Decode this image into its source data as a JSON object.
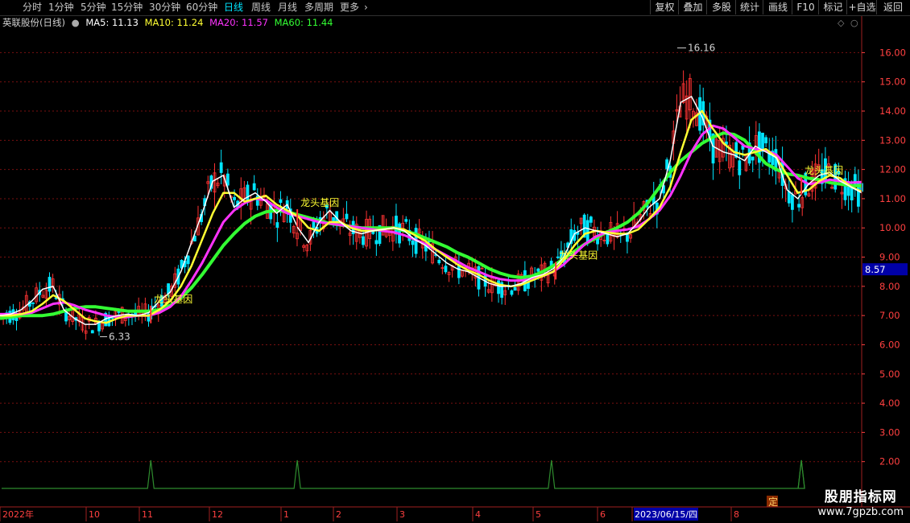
{
  "toolbar": {
    "period_tabs": [
      "分时",
      "1分钟",
      "5分钟",
      "15分钟",
      "30分钟",
      "60分钟",
      "日线",
      "周线",
      "月线",
      "多周期",
      "更多"
    ],
    "active_tab": "日线",
    "more_arrow": "›",
    "right_buttons": [
      "复权",
      "叠加",
      "多股",
      "统计",
      "画线",
      "F10",
      "标记",
      "+自选",
      "返回"
    ]
  },
  "legend": {
    "stock_name": "英联股份(日线)",
    "ma5": "MA5: 11.13",
    "ma10": "MA10: 11.24",
    "ma20": "MA20: 11.57",
    "ma60": "MA60: 11.44"
  },
  "colors": {
    "ma5": "#ffffff",
    "ma10": "#ffff33",
    "ma20": "#ff33ff",
    "ma60": "#33ff33",
    "up": "#ff3333",
    "down": "#00e5ff",
    "axis": "#ff4040",
    "signal": "#2e8b2e",
    "current_price_bg": "#0000a8"
  },
  "chart_data": {
    "type": "candlestick",
    "ylim": [
      1.0,
      16.7
    ],
    "y_ticks": [
      "16.00",
      "15.00",
      "14.00",
      "13.00",
      "12.00",
      "11.00",
      "10.00",
      "9.00",
      "8.00",
      "7.00",
      "6.00",
      "5.00",
      "4.00",
      "3.00",
      "2.00"
    ],
    "x_labels": [
      "2022年",
      "10",
      "11",
      "12",
      "1",
      "2",
      "3",
      "4",
      "5",
      "6",
      "2023/06/15/四",
      "8"
    ],
    "highlighted_date": "2023/06/15/四",
    "current_price": "8.57",
    "high_label": "16.16",
    "low_label": "6.33",
    "annotation_text": "龙头基因",
    "signal_marker": "定",
    "ma_series": {
      "ma5": [
        7.0,
        7.05,
        7.2,
        7.5,
        7.9,
        8.0,
        7.2,
        6.9,
        6.7,
        6.7,
        6.9,
        7.0,
        7.05,
        7.0,
        7.1,
        7.5,
        7.8,
        8.5,
        9.5,
        10.5,
        11.6,
        11.8,
        10.7,
        11.0,
        11.2,
        10.9,
        10.5,
        10.8,
        10.0,
        9.5,
        10.2,
        10.6,
        10.2,
        9.9,
        9.8,
        9.9,
        9.95,
        10.0,
        9.9,
        9.6,
        9.4,
        9.1,
        8.8,
        8.6,
        8.5,
        8.3,
        8.1,
        8.0,
        8.0,
        8.1,
        8.3,
        8.4,
        8.6,
        9.0,
        9.8,
        10.0,
        9.9,
        9.8,
        9.7,
        9.8,
        10.2,
        10.7,
        11.0,
        12.3,
        14.3,
        14.5,
        13.8,
        12.8,
        12.6,
        12.5,
        12.3,
        12.8,
        12.6,
        12.4,
        11.3,
        11.0,
        11.5,
        11.8,
        11.9,
        11.6,
        11.4,
        11.2
      ],
      "ma10": [
        7.0,
        7.0,
        7.05,
        7.15,
        7.4,
        7.7,
        7.5,
        7.2,
        6.9,
        6.8,
        6.75,
        6.9,
        7.0,
        7.0,
        7.0,
        7.2,
        7.5,
        8.0,
        8.7,
        9.6,
        10.5,
        11.2,
        11.2,
        10.9,
        11.0,
        11.1,
        10.8,
        10.6,
        10.4,
        10.0,
        9.9,
        10.2,
        10.2,
        10.0,
        9.9,
        9.9,
        9.95,
        10.0,
        9.95,
        9.75,
        9.55,
        9.25,
        9.0,
        8.75,
        8.55,
        8.4,
        8.2,
        8.05,
        8.0,
        8.05,
        8.2,
        8.35,
        8.5,
        8.9,
        9.4,
        9.8,
        9.9,
        9.85,
        9.8,
        9.8,
        9.95,
        10.3,
        10.7,
        11.4,
        12.6,
        13.7,
        14.0,
        13.4,
        12.9,
        12.6,
        12.5,
        12.6,
        12.7,
        12.4,
        11.8,
        11.2,
        11.3,
        11.6,
        11.8,
        11.7,
        11.4,
        11.24
      ],
      "ma20": [
        7.05,
        7.05,
        7.05,
        7.1,
        7.25,
        7.4,
        7.45,
        7.35,
        7.2,
        7.1,
        7.0,
        6.95,
        6.95,
        7.0,
        7.0,
        7.1,
        7.3,
        7.65,
        8.2,
        8.8,
        9.5,
        10.2,
        10.6,
        10.85,
        11.0,
        10.95,
        10.7,
        10.5,
        10.4,
        10.3,
        10.2,
        10.15,
        10.1,
        10.05,
        10.0,
        9.95,
        9.9,
        9.85,
        9.75,
        9.6,
        9.45,
        9.25,
        9.05,
        8.85,
        8.65,
        8.5,
        8.35,
        8.25,
        8.2,
        8.2,
        8.25,
        8.35,
        8.5,
        8.75,
        9.1,
        9.45,
        9.7,
        9.85,
        9.9,
        9.95,
        10.05,
        10.3,
        10.6,
        11.1,
        11.8,
        12.6,
        13.2,
        13.5,
        13.4,
        13.1,
        12.8,
        12.7,
        12.65,
        12.5,
        12.1,
        11.7,
        11.5,
        11.55,
        11.65,
        11.6,
        11.55,
        11.57
      ],
      "ma60": [
        6.9,
        6.95,
        7.0,
        7.0,
        7.0,
        7.05,
        7.15,
        7.25,
        7.3,
        7.3,
        7.25,
        7.2,
        7.15,
        7.15,
        7.15,
        7.2,
        7.35,
        7.6,
        7.95,
        8.4,
        8.9,
        9.4,
        9.8,
        10.15,
        10.4,
        10.55,
        10.6,
        10.55,
        10.45,
        10.35,
        10.25,
        10.15,
        10.1,
        10.05,
        10.0,
        10.0,
        10.0,
        10.0,
        9.9,
        9.8,
        9.65,
        9.5,
        9.35,
        9.15,
        9.0,
        8.8,
        8.6,
        8.45,
        8.35,
        8.3,
        8.35,
        8.5,
        8.7,
        8.95,
        9.2,
        9.45,
        9.65,
        9.85,
        10.0,
        10.2,
        10.5,
        10.9,
        11.4,
        11.9,
        12.3,
        12.6,
        12.9,
        13.1,
        13.25,
        13.2,
        13.0,
        12.6,
        12.2,
        12.0,
        11.85,
        11.8,
        11.7,
        11.65,
        11.55,
        11.5,
        11.45,
        11.44
      ]
    },
    "signal_points": [
      0.175,
      0.345,
      0.64,
      0.93
    ],
    "annotation_points": [
      [
        0.175,
        7.45
      ],
      [
        0.345,
        10.75
      ],
      [
        0.645,
        8.95
      ],
      [
        0.93,
        11.85
      ]
    ],
    "high_point": [
      0.785,
      16.16
    ],
    "low_point": [
      0.115,
      6.33
    ]
  },
  "watermark": {
    "title": "股朋指标网",
    "url": "www.7gpzb.com"
  }
}
